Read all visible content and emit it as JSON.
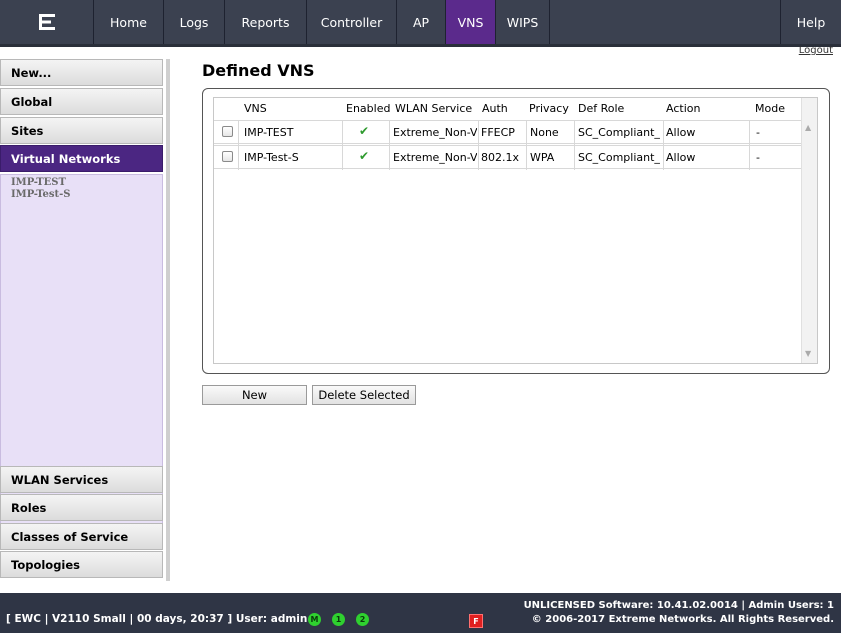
{
  "nav": {
    "tabs": [
      {
        "label": "Home"
      },
      {
        "label": "Logs"
      },
      {
        "label": "Reports"
      },
      {
        "label": "Controller"
      },
      {
        "label": "AP"
      },
      {
        "label": "VNS"
      },
      {
        "label": "WIPS"
      },
      {
        "label": "Help"
      }
    ],
    "active_tab": "VNS",
    "logout": "Logout",
    "logo_icon": "extreme-networks-logo",
    "active_color": "#5b2a8c"
  },
  "sidebar": {
    "items_top": [
      {
        "label": "New..."
      },
      {
        "label": "Global"
      },
      {
        "label": "Sites"
      },
      {
        "label": "Virtual Networks"
      }
    ],
    "sub_links": [
      {
        "label": "IMP-TEST"
      },
      {
        "label": "IMP-Test-S"
      }
    ],
    "items_bottom": [
      {
        "label": "WLAN Services"
      },
      {
        "label": "Roles"
      },
      {
        "label": "Classes of Service"
      },
      {
        "label": "Topologies"
      }
    ],
    "active_item": "Virtual Networks"
  },
  "main": {
    "title": "Defined VNS",
    "columns": [
      "VNS",
      "Enabled",
      "WLAN Service",
      "Auth",
      "Privacy",
      "Def Role",
      "Action",
      "Mode"
    ],
    "rows": [
      {
        "vns": "IMP-TEST",
        "enabled": true,
        "wlan_service": "Extreme_Non-V",
        "auth": "FFECP",
        "privacy": "None",
        "def_role": "SC_Compliant_",
        "action": "Allow",
        "mode": "-"
      },
      {
        "vns": "IMP-Test-S",
        "enabled": true,
        "wlan_service": "Extreme_Non-V",
        "auth": "802.1x",
        "privacy": "WPA",
        "def_role": "SC_Compliant_",
        "action": "Allow",
        "mode": "-"
      }
    ],
    "buttons": {
      "new": "New",
      "delete": "Delete Selected"
    }
  },
  "footer": {
    "left": "[ EWC | V2110 Small | 00 days, 20:37 ]  User: admin",
    "status_icons": [
      {
        "glyph": "M",
        "name": "mode-status-icon"
      },
      {
        "glyph": "1",
        "name": "status-1-icon"
      },
      {
        "glyph": "2",
        "name": "status-2-icon"
      }
    ],
    "fault_glyph": "F",
    "right_line1": "UNLICENSED Software: 10.41.02.0014 | Admin Users: 1",
    "right_line2": "© 2006-2017  Extreme Networks. All Rights Reserved."
  }
}
